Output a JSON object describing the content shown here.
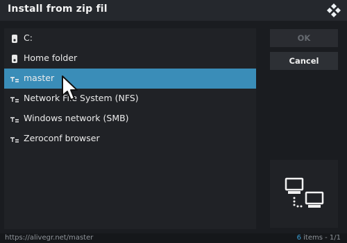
{
  "dialog": {
    "title": "Install from zip fil"
  },
  "list": {
    "items": [
      {
        "label": "C:",
        "icon": "drive-icon"
      },
      {
        "label": "Home folder",
        "icon": "drive-icon"
      },
      {
        "label": "master",
        "icon": "network-share-icon",
        "selected": true
      },
      {
        "label": "Network File System (NFS)",
        "icon": "network-share-icon"
      },
      {
        "label": "Windows network (SMB)",
        "icon": "network-share-icon"
      },
      {
        "label": "Zeroconf browser",
        "icon": "network-share-icon"
      }
    ]
  },
  "buttons": {
    "ok": "OK",
    "cancel": "Cancel"
  },
  "status": {
    "path": "https://alivegr.net/master",
    "count_num": "6",
    "count_text": " items - 1/1"
  },
  "colors": {
    "accent": "#3a8db8",
    "background": "#1a1c20"
  }
}
